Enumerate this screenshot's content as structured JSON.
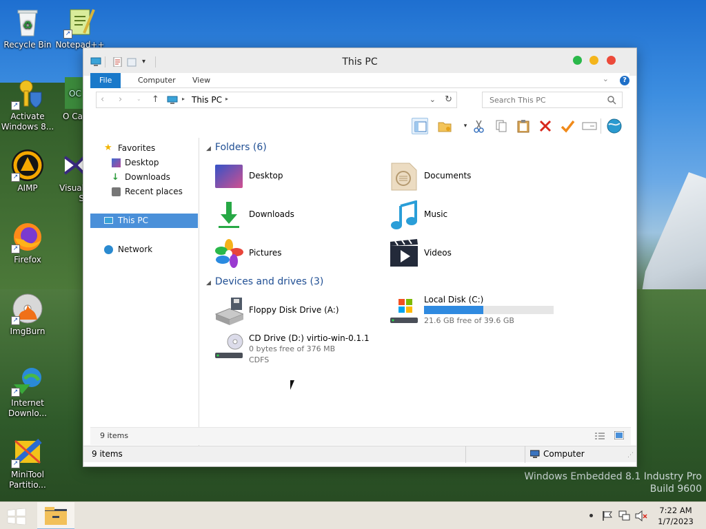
{
  "desktop": {
    "icons": [
      {
        "label": "Recycle Bin",
        "icon": "recycle-bin-icon"
      },
      {
        "label": "Notepad++",
        "icon": "notepad-plus-plus-icon"
      },
      {
        "label": "Activate Windows 8...",
        "icon": "key-shield-icon"
      },
      {
        "label": "O Ca",
        "icon": "app-icon"
      },
      {
        "label": "AIMP",
        "icon": "aimp-icon"
      },
      {
        "label": "Visual S",
        "icon": "visual-studio-icon"
      },
      {
        "label": "Firefox",
        "icon": "firefox-icon"
      },
      {
        "label": "ImgBurn",
        "icon": "imgburn-icon"
      },
      {
        "label": "Internet Downlo...",
        "icon": "internet-download-manager-icon"
      },
      {
        "label": "MiniTool Partitio...",
        "icon": "minitool-partition-icon"
      }
    ],
    "watermark_line1": "Windows Embedded 8.1 Industry Pro",
    "watermark_line2": "Build 9600"
  },
  "window": {
    "title": "This PC",
    "ribbon_tabs": [
      "File",
      "Computer",
      "View"
    ],
    "address": {
      "location_label": "This PC"
    },
    "search_placeholder": "Search This PC",
    "nav": {
      "favorites": "Favorites",
      "desktop": "Desktop",
      "downloads": "Downloads",
      "recent": "Recent places",
      "this_pc": "This PC",
      "network": "Network"
    },
    "folders_header": "Folders (6)",
    "folders": [
      {
        "name": "Desktop",
        "icon": "desktop-folder-icon"
      },
      {
        "name": "Documents",
        "icon": "documents-folder-icon"
      },
      {
        "name": "Downloads",
        "icon": "downloads-folder-icon"
      },
      {
        "name": "Music",
        "icon": "music-folder-icon"
      },
      {
        "name": "Pictures",
        "icon": "pictures-folder-icon"
      },
      {
        "name": "Videos",
        "icon": "videos-folder-icon"
      }
    ],
    "drives_header": "Devices and drives (3)",
    "drives": {
      "floppy": {
        "name": "Floppy Disk Drive (A:)"
      },
      "local": {
        "name": "Local Disk (C:)",
        "free_text": "21.6 GB free of 39.6 GB",
        "used_fraction": 0.455
      },
      "cd": {
        "name": "CD Drive (D:) virtio-win-0.1.1",
        "free_text": "0 bytes free of 376 MB",
        "fs": "CDFS"
      }
    },
    "status_count": "9 items",
    "status_count2": "9 items",
    "status_location": "Computer"
  },
  "taskbar": {
    "time": "7:22 AM",
    "date": "1/7/2023"
  }
}
